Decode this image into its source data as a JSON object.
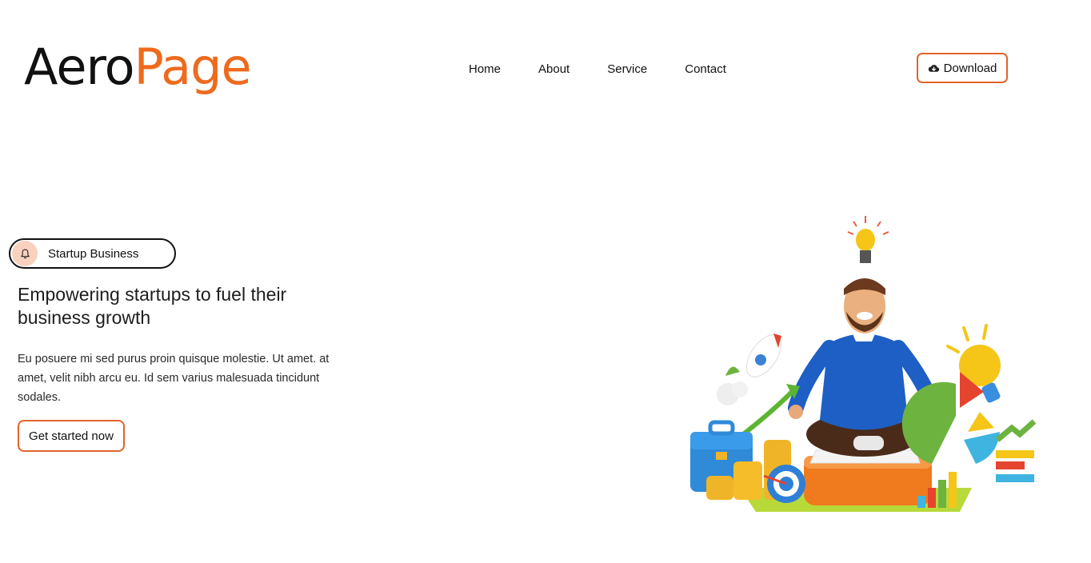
{
  "header": {
    "logo": {
      "part1": "Aero",
      "part2": "Page"
    },
    "nav": [
      {
        "label": "Home"
      },
      {
        "label": "About"
      },
      {
        "label": "Service"
      },
      {
        "label": "Contact"
      }
    ],
    "download": {
      "label": "Download",
      "icon": "cloud-download-icon"
    }
  },
  "hero": {
    "badge": {
      "label": "Startup Business",
      "icon": "bell-icon"
    },
    "headline": "Empowering startups to fuel their business growth",
    "body": "Eu posuere mi sed purus proin quisque molestie. Ut amet. at amet, velit nibh arcu eu. Id sem varius malesuada tincidunt sodales.",
    "cta_label": "Get started now",
    "illustration": "meditating-businessman-illustration"
  },
  "colors": {
    "accent": "#ee6a1d",
    "button_border": "#e1642a",
    "badge_icon_bg": "#f8d2bf",
    "text": "#111111"
  }
}
